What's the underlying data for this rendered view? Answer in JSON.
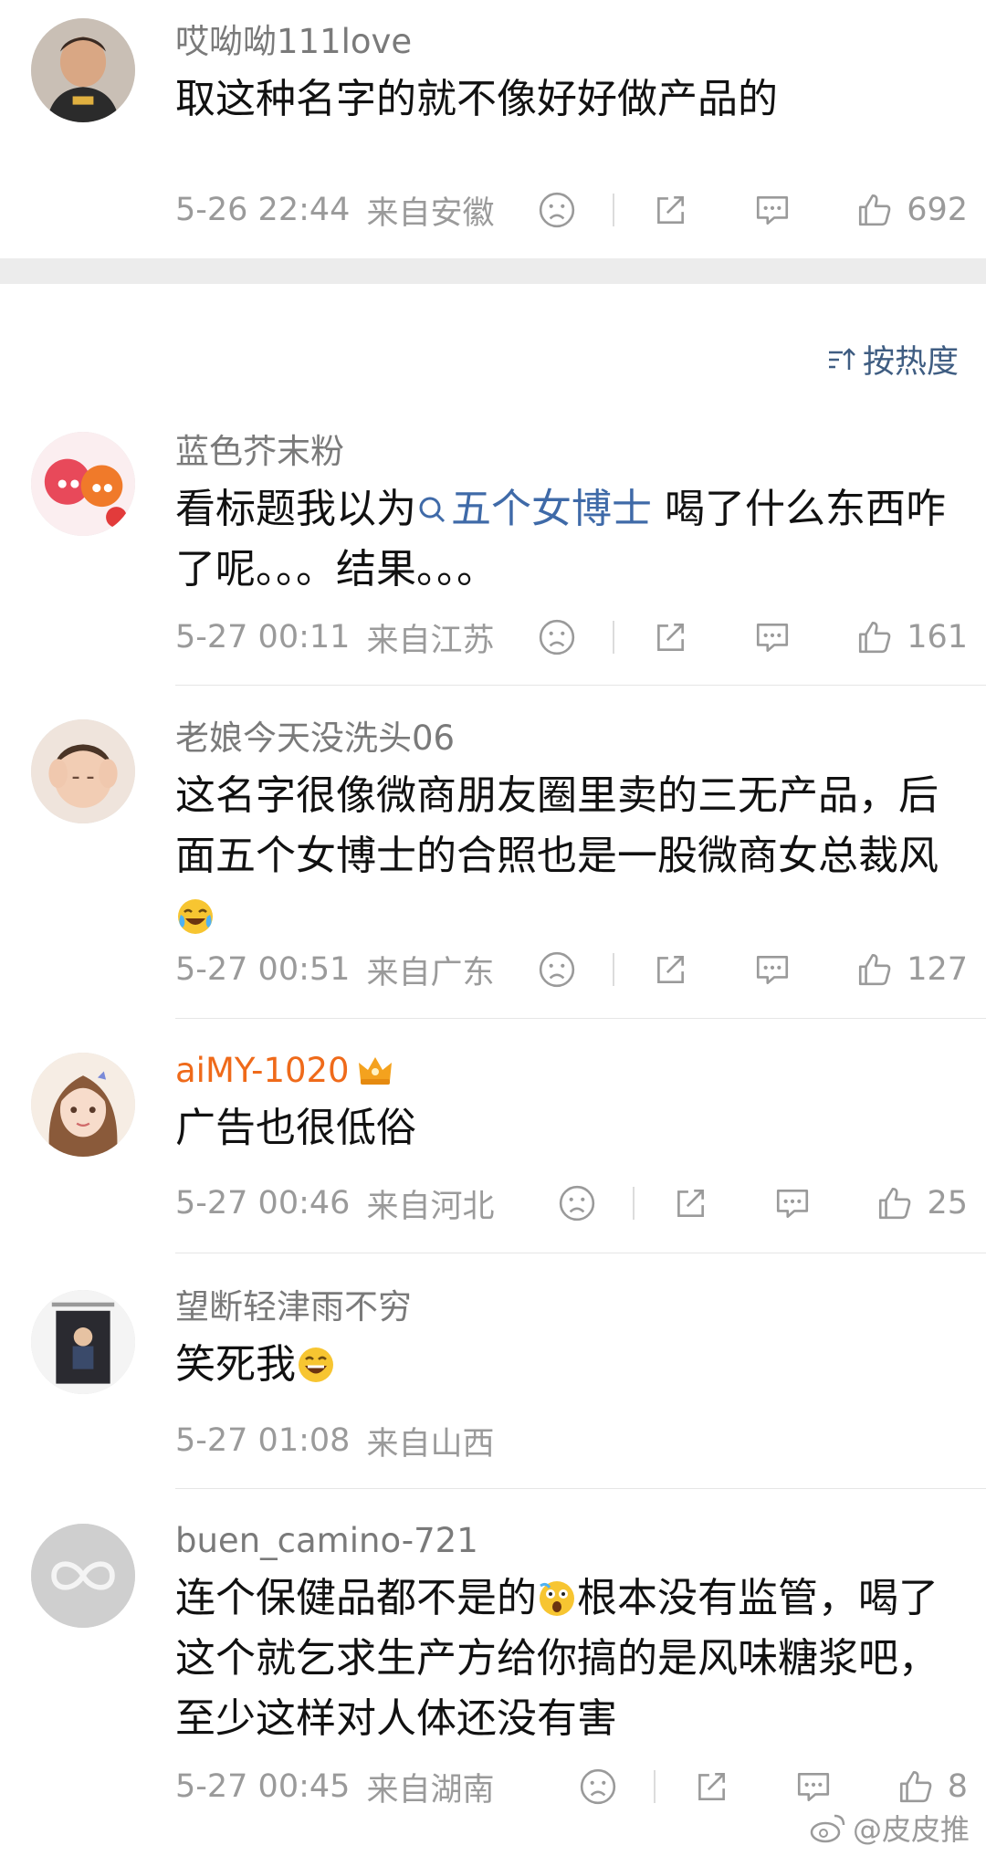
{
  "sort_label": "按热度",
  "watermark_text": "@皮皮推",
  "comments": [
    {
      "username": "哎呦呦111love",
      "text": "取这种名字的就不像好好做产品的",
      "time": "5-26 22:44",
      "location": "来自安徽",
      "likes": "692"
    },
    {
      "username": "蓝色芥末粉",
      "text_before": "看标题我以为",
      "topic": "五个女博士",
      "text_after": " 喝了什么东西咋了呢。。。结果。。。",
      "time": "5-27 00:11",
      "location": "来自江苏",
      "likes": "161"
    },
    {
      "username": "老娘今天没洗头06",
      "text": "这名字很像微商朋友圈里卖的三无产品，后面五个女博士的合照也是一股微商女总裁风",
      "emoji": "laughing-crying-emoji",
      "time": "5-27 00:51",
      "location": "来自广东",
      "likes": "127"
    },
    {
      "username": "aiMY-1020",
      "badge": "crown-badge",
      "text": "广告也很低俗",
      "time": "5-27 00:46",
      "location": "来自河北",
      "likes": "25"
    },
    {
      "username": "望断轻津雨不穷",
      "text": "笑死我",
      "emoji": "grinning-emoji",
      "time": "5-27 01:08",
      "location": "来自山西"
    },
    {
      "username": "buen_camino-721",
      "text_before": "连个保健品都不是的",
      "emoji": "scared-emoji",
      "text_after": "根本没有监管，喝了这个就乞求生产方给你搞的是风味糖浆吧，至少这样对人体还没有害",
      "time": "5-27 00:45",
      "location": "来自湖南",
      "likes": "8"
    }
  ],
  "colors": {
    "vip_name": "#ef6a1a",
    "topic_link": "#3f6aa8",
    "meta": "#9a9a9a"
  }
}
